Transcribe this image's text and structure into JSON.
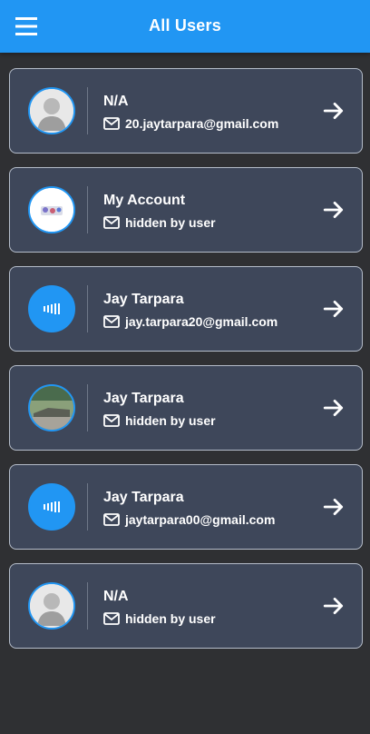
{
  "app_bar": {
    "title": "All Users"
  },
  "colors": {
    "accent": "#2196f3",
    "card_background": "#3e475a",
    "page_background": "#2f3033"
  },
  "users": [
    {
      "name": "N/A",
      "email": "20.jaytarpara@gmail.com",
      "avatar": "default-person-avatar"
    },
    {
      "name": "My Account",
      "email": "hidden by user",
      "avatar": "sticker-avatar"
    },
    {
      "name": "Jay Tarpara",
      "email": "jay.tarpara20@gmail.com",
      "avatar": "soundwave-logo-avatar"
    },
    {
      "name": "Jay Tarpara",
      "email": "hidden by user",
      "avatar": "landscape-photo-avatar"
    },
    {
      "name": "Jay Tarpara",
      "email": "jaytarpara00@gmail.com",
      "avatar": "soundwave-logo-avatar"
    },
    {
      "name": "N/A",
      "email": "hidden by user",
      "avatar": "default-person-avatar"
    }
  ]
}
